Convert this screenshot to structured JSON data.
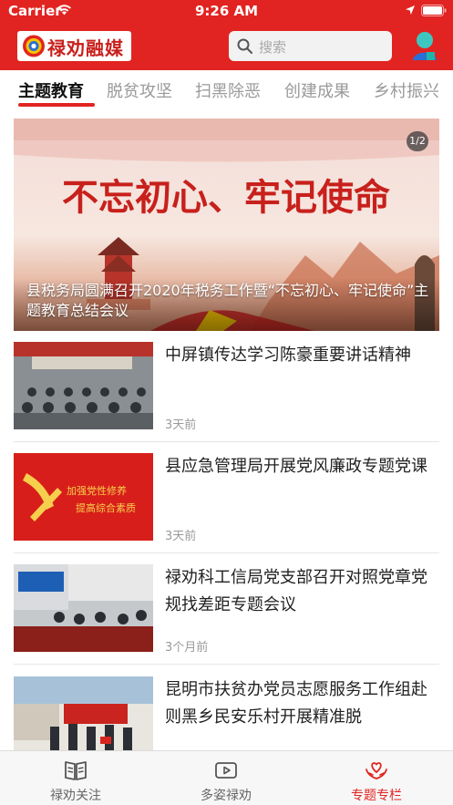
{
  "status": {
    "carrier": "Carrier",
    "time": "9:26 AM"
  },
  "header": {
    "logo_text": "禄劝融媒",
    "search_placeholder": "搜索"
  },
  "tabs": [
    {
      "label": "主题教育",
      "active": true
    },
    {
      "label": "脱贫攻坚",
      "active": false
    },
    {
      "label": "扫黑除恶",
      "active": false
    },
    {
      "label": "创建成果",
      "active": false
    },
    {
      "label": "乡村振兴",
      "active": false
    }
  ],
  "banner": {
    "headline": "不忘初心、牢记使命",
    "page_indicator": "1/2",
    "caption": "县税务局圆满召开2020年税务工作暨“不忘初心、牢记使命”主题教育总结会议"
  },
  "articles": [
    {
      "title": "中屏镇传达学习陈豪重要讲话精神",
      "time": "3天前"
    },
    {
      "title": "县应急管理局开展党风廉政专题党课",
      "time": "3天前",
      "thumb_text": [
        "加强党性修养",
        "提高综合素质"
      ]
    },
    {
      "title": "禄劝科工信局党支部召开对照党章党规找差距专题会议",
      "time": "3个月前"
    },
    {
      "title": "昆明市扶贫办党员志愿服务工作组赴则黑乡民安乐村开展精准脱",
      "time": ""
    }
  ],
  "bottom_nav": [
    {
      "label": "禄劝关注",
      "icon": "book-icon",
      "active": false
    },
    {
      "label": "多姿禄劝",
      "icon": "video-icon",
      "active": false
    },
    {
      "label": "专题专栏",
      "icon": "hands-heart-icon",
      "active": true
    }
  ],
  "colors": {
    "brand_red": "#e12421",
    "inactive_tab": "#9a9a9a"
  }
}
